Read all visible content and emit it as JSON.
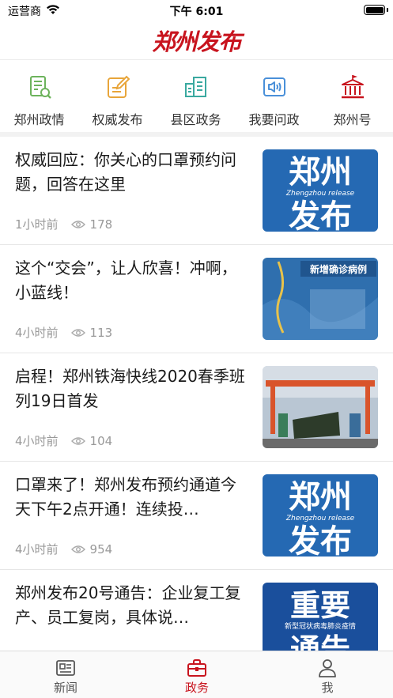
{
  "status_bar": {
    "carrier": "运营商",
    "time": "下午 6:01"
  },
  "header": {
    "logo_text": "郑州发布",
    "brand_color": "#c8141e"
  },
  "quick_nav": [
    {
      "label": "郑州政情",
      "icon": "document-pen-icon"
    },
    {
      "label": "权威发布",
      "icon": "edit-note-icon"
    },
    {
      "label": "县区政务",
      "icon": "buildings-icon"
    },
    {
      "label": "我要问政",
      "icon": "speaker-icon"
    },
    {
      "label": "郑州号",
      "icon": "government-building-icon"
    }
  ],
  "news": [
    {
      "title": "权威回应：你关心的口罩预约问题，回答在这里",
      "time": "1小时前",
      "views": "178",
      "thumb": {
        "type": "brand",
        "line1": "郑州",
        "sub": "Zhengzhou release",
        "line2": "发布"
      }
    },
    {
      "title": "这个“交会”，让人欣喜！冲啊，小蓝线！",
      "time": "4小时前",
      "views": "113",
      "thumb": {
        "type": "map",
        "caption": "新增确诊病例"
      }
    },
    {
      "title": "启程！郑州铁海快线2020春季班列19日首发",
      "time": "4小时前",
      "views": "104",
      "thumb": {
        "type": "train"
      }
    },
    {
      "title": "口罩来了！郑州发布预约通道今天下午2点开通！连续投…",
      "time": "4小时前",
      "views": "954",
      "thumb": {
        "type": "brand",
        "line1": "郑州",
        "sub": "Zhengzhou release",
        "line2": "发布"
      }
    },
    {
      "title": "郑州发布20号通告：企业复工复产、员工复岗，具体说…",
      "time": "",
      "views": "",
      "thumb": {
        "type": "notice",
        "line1": "重要",
        "sub": "新型冠状病毒肺炎疫情",
        "line2": "通告"
      }
    }
  ],
  "tab_bar": [
    {
      "label": "新闻",
      "icon": "newspaper-icon",
      "active": false
    },
    {
      "label": "政务",
      "icon": "briefcase-icon",
      "active": true
    },
    {
      "label": "我",
      "icon": "person-icon",
      "active": false
    }
  ]
}
